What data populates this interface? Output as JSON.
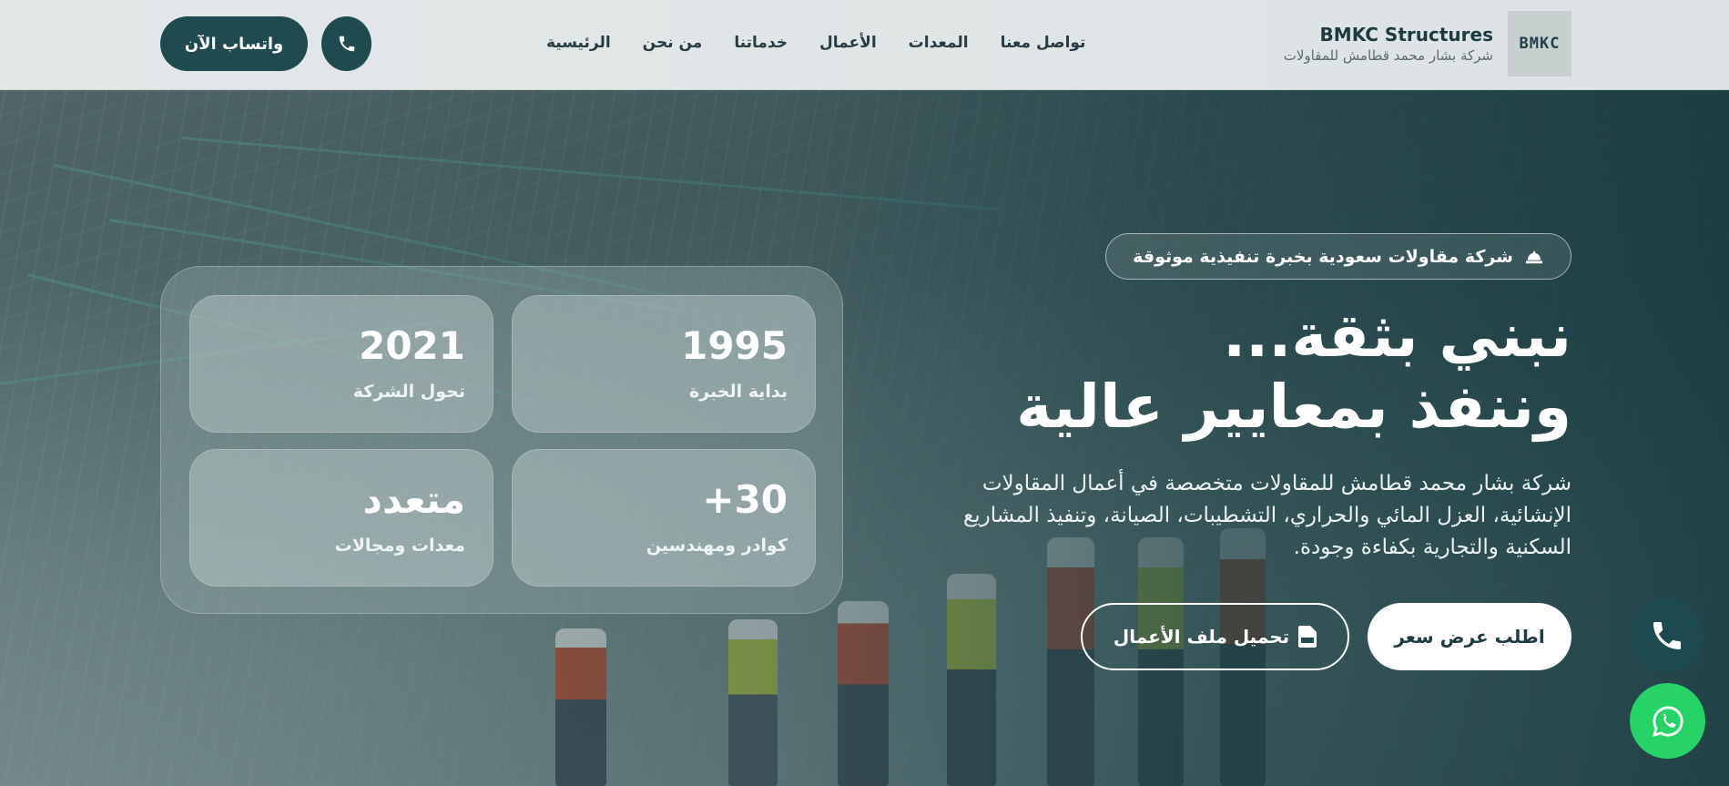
{
  "colors": {
    "header_bg": "#e3e7e8",
    "primary": "#1e4a50",
    "whatsapp": "#25d366",
    "text_dark": "#1d3a40",
    "white": "#ffffff"
  },
  "header": {
    "brand_title": "BMKC Structures",
    "brand_subtitle": "شركة بشار محمد قطامش للمقاولات",
    "logo_text": "BMKC",
    "nav": [
      {
        "label": "الرئيسية"
      },
      {
        "label": "من نحن"
      },
      {
        "label": "خدماتنا"
      },
      {
        "label": "الأعمال"
      },
      {
        "label": "المعدات"
      },
      {
        "label": "تواصل معنا"
      }
    ],
    "whatsapp_button": "واتساب الآن",
    "call_icon": "phone-icon"
  },
  "hero": {
    "badge": "شركة مقاولات سعودية بخبرة تنفيذية موثوقة",
    "badge_icon": "helmet-icon",
    "headline_line1": "نبني بثقة...",
    "headline_line2": "وننفذ بمعايير عالية",
    "description": "شركة بشار محمد قطامش للمقاولات متخصصة في أعمال المقاولات الإنشائية، العزل المائي والحراري، التشطيبات، الصيانة، وتنفيذ المشاريع السكنية والتجارية بكفاءة وجودة.",
    "quote_button": "اطلب عرض سعر",
    "download_button": "تحميل ملف الأعمال",
    "download_icon": "file-pdf-icon"
  },
  "stats": [
    {
      "value": "1995",
      "label": "بداية الخبرة"
    },
    {
      "value": "2021",
      "label": "تحول الشركة"
    },
    {
      "value": "30+",
      "label": "كوادر ومهندسين"
    },
    {
      "value": "متعدد",
      "label": "معدات ومجالات"
    }
  ],
  "floating": {
    "call_icon": "phone-icon",
    "whatsapp_icon": "whatsapp-icon"
  }
}
